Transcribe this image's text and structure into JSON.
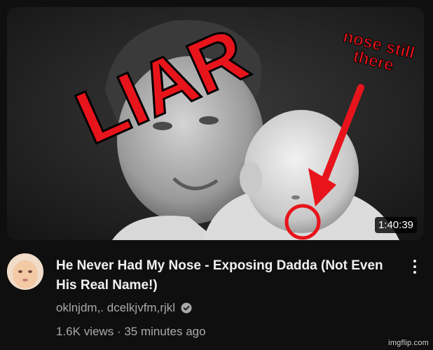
{
  "video": {
    "thumbnail": {
      "overlay_main_text": "LIAR",
      "overlay_note_line1": "nose still",
      "overlay_note_line2": "there",
      "accent_color": "#e8141b"
    },
    "duration": "1:40:39",
    "title": "He Never Had My Nose - Exposing Dadda (Not Even His Real Name!)",
    "channel_name": "oklnjdm,. dcelkjvfm,rjkl",
    "views": "1.6K views",
    "separator": "·",
    "age": "35 minutes ago"
  },
  "icons": {
    "verified": "check-circle-icon",
    "more": "more-vertical-icon"
  },
  "watermark": "imgflip.com"
}
